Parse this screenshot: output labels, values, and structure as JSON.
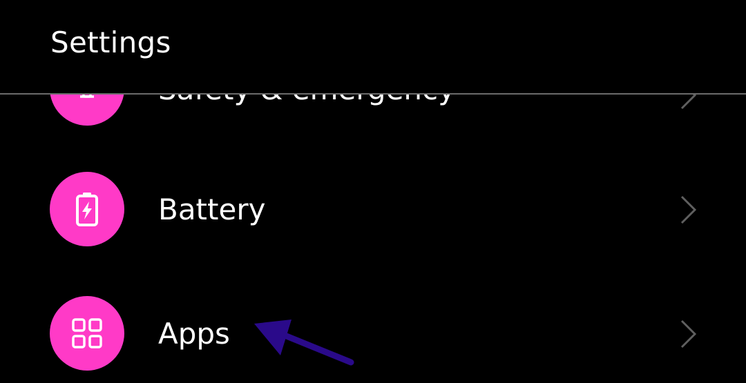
{
  "header": {
    "title": "Settings"
  },
  "settings_items": [
    {
      "label": "Safety & emergency",
      "icon": "safety-emergency-icon"
    },
    {
      "label": "Battery",
      "icon": "battery-icon"
    },
    {
      "label": "Apps",
      "icon": "apps-grid-icon"
    }
  ],
  "colors": {
    "background": "#000000",
    "icon_circle": "#ff3ac7",
    "text": "#ffffff",
    "chevron": "#5f5f5f",
    "divider": "#6b6b6b",
    "annotation_arrow": "#2a0a8a"
  },
  "annotation": {
    "arrow_target": "Apps"
  }
}
